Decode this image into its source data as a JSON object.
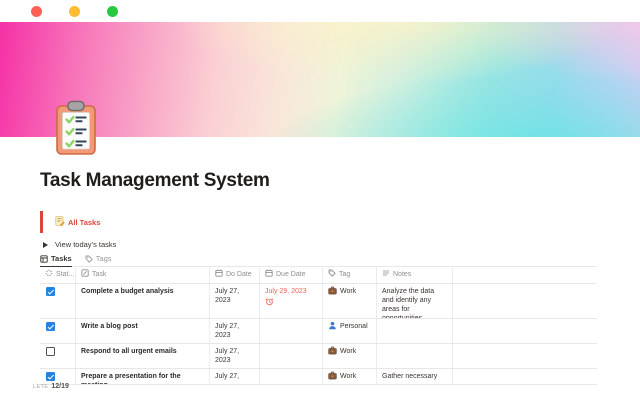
{
  "window": {
    "controls": [
      {
        "name": "close-button",
        "color": "#ff5f57"
      },
      {
        "name": "minimize-button",
        "color": "#febc2e"
      },
      {
        "name": "zoom-button",
        "color": "#28c840"
      }
    ]
  },
  "cover": {
    "style": "rainbow-gradient",
    "page_icon": "clipboard-checklist",
    "gradient_colors": [
      "#f630a6",
      "#f9a8c8",
      "#f9e6da",
      "#eff4d9",
      "#94e9e0",
      "#b8d9f0",
      "#e4cdee"
    ]
  },
  "page": {
    "title": "Task Management System",
    "callout": {
      "icon": "memo-icon",
      "text": "All Tasks",
      "color": "#d9463b"
    },
    "toggle": {
      "label": "View today’s tasks",
      "state": "collapsed"
    },
    "tabs": [
      {
        "label": "Tasks",
        "icon": "table-doc-icon",
        "active": true
      },
      {
        "label": "Tags",
        "icon": "tag-icon",
        "active": false
      }
    ]
  },
  "table": {
    "columns": [
      {
        "label": "Stat...",
        "icon": "status-icon"
      },
      {
        "label": "Task",
        "icon": "pencil-icon"
      },
      {
        "label": "Do Date",
        "icon": "calendar-icon"
      },
      {
        "label": "Due Date",
        "icon": "calendar-icon"
      },
      {
        "label": "Tag",
        "icon": "tag-icon"
      },
      {
        "label": "Notes",
        "icon": "text-lines-icon"
      },
      {
        "label": "",
        "icon": ""
      }
    ],
    "rows": [
      {
        "checked": true,
        "task": "Complete a budget analysis",
        "do_date": "July 27, 2023",
        "due_date": "July 29, 2023",
        "due_overdue": true,
        "due_reminder": true,
        "due_icon": "alarm-clock-icon",
        "tag": {
          "icon": "briefcase-icon",
          "label": "Work"
        },
        "notes": "Analyze the data and identify any areas for opportunities"
      },
      {
        "checked": true,
        "task": "Write a blog post",
        "do_date": "July 27, 2023",
        "due_date": "",
        "due_overdue": false,
        "due_reminder": false,
        "due_icon": "",
        "tag": {
          "icon": "person-icon",
          "label": "Personal"
        },
        "notes": ""
      },
      {
        "checked": false,
        "task": "Respond to all urgent emails",
        "do_date": "July 27, 2023",
        "due_date": "",
        "due_overdue": false,
        "due_reminder": false,
        "due_icon": "",
        "tag": {
          "icon": "briefcase-icon",
          "label": "Work"
        },
        "notes": ""
      },
      {
        "checked": true,
        "task": "Prepare a presentation for the meeting",
        "do_date": "July 27,",
        "due_date": "",
        "due_overdue": false,
        "due_reminder": false,
        "due_icon": "",
        "tag": {
          "icon": "briefcase-icon",
          "label": "Work"
        },
        "notes": "Gather necessary"
      }
    ],
    "footer": {
      "calc_label": "LETE",
      "calc_value": "12/19"
    }
  },
  "colors": {
    "checkbox_blue": "#2383e2",
    "overdue_red": "#eb6157",
    "callout_red": "#d9463b",
    "text": "#37352f",
    "muted": "#9b9a97",
    "border": "#e8e7e5"
  }
}
